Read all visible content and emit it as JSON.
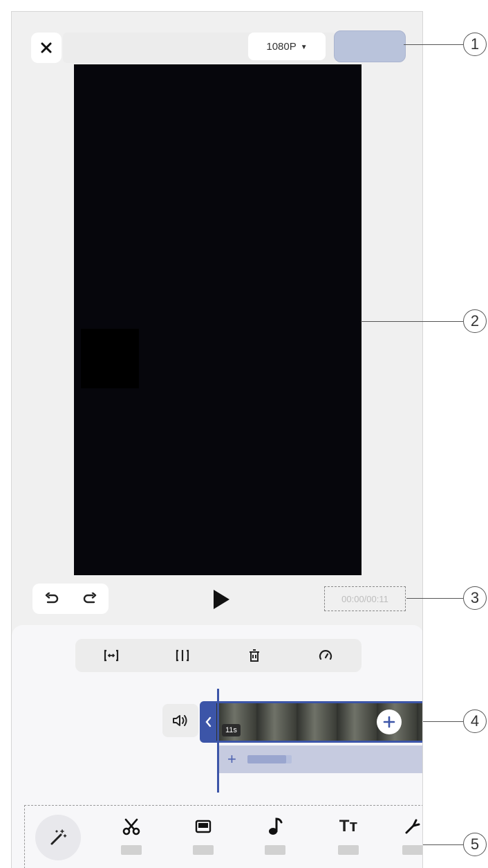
{
  "topbar": {
    "resolution": "1080P",
    "close_icon": "close-icon",
    "export_label": ""
  },
  "player": {
    "timecode": "00:00/00:11"
  },
  "timeline": {
    "clip_duration": "11s",
    "audio_add": "+"
  },
  "edit_tools": [
    "trim-icon",
    "split-icon",
    "delete-icon",
    "speed-icon"
  ],
  "bottom_tools": [
    "magic-wand-icon",
    "cut-icon",
    "template-icon",
    "music-icon",
    "text-icon",
    "sticker-icon"
  ],
  "text_tool_glyph": "Tт",
  "callouts": [
    "1",
    "2",
    "3",
    "4",
    "5"
  ],
  "colors": {
    "accent": "#3c55a8",
    "export_button": "#b9c3db",
    "preview_bg": "#06060c",
    "audio_track": "#c6cbe0"
  }
}
